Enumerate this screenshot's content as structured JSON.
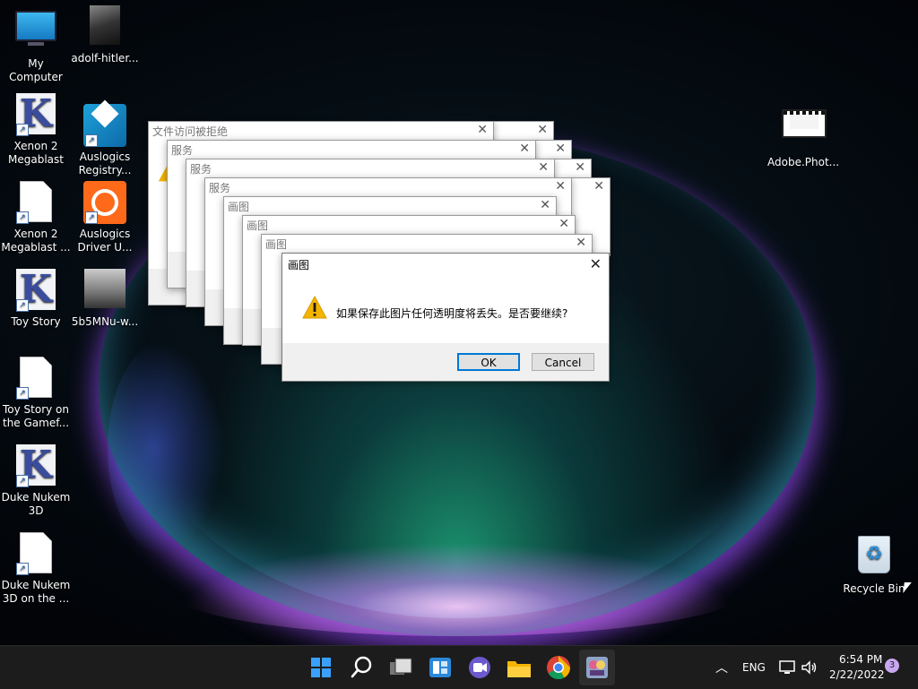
{
  "desktop": {
    "icons": [
      {
        "label": "My Computer"
      },
      {
        "label": "adolf-hitler..."
      },
      {
        "label": "Xenon 2 Megablast"
      },
      {
        "label": "Auslogics Registry..."
      },
      {
        "label": "Xenon 2 Megablast ..."
      },
      {
        "label": "Auslogics Driver U..."
      },
      {
        "label": "Toy Story"
      },
      {
        "label": "5b5MNu-w..."
      },
      {
        "label": "Toy Story on the Gamef..."
      },
      {
        "label": "Duke Nukem 3D"
      },
      {
        "label": "Duke Nukem 3D on the ..."
      },
      {
        "label": "Adobe.Phot..."
      },
      {
        "label": "Recycle Bin"
      }
    ]
  },
  "dialogs": {
    "background": [
      {
        "title": "文件访问被拒绝"
      },
      {
        "title": "服务"
      },
      {
        "title": "服务"
      },
      {
        "title": "服务"
      },
      {
        "title": "画图"
      },
      {
        "title": "画图"
      },
      {
        "title": "画图"
      }
    ],
    "active": {
      "title": "画图",
      "message": "如果保存此图片任何透明度将丢失。是否要继续?",
      "ok_label": "OK",
      "cancel_label": "Cancel"
    },
    "close_glyph": "✕"
  },
  "taskbar": {
    "language": "ENG",
    "time": "6:54 PM",
    "date": "2/22/2022",
    "notification_count": "3",
    "chevron_glyph": "︿"
  },
  "colors": {
    "accent": "#0078d7",
    "taskbar_bg": "#1c1c1c",
    "start_blue": "#3aa0ff"
  }
}
